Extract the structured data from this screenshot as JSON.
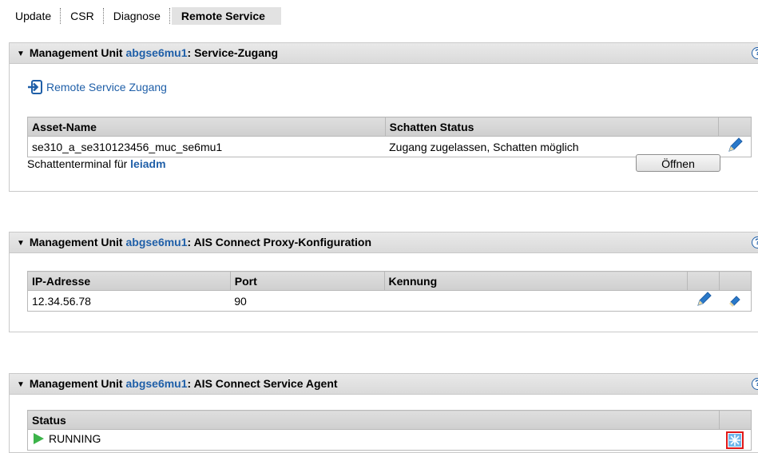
{
  "tabs": [
    {
      "label": "Update"
    },
    {
      "label": "CSR"
    },
    {
      "label": "Diagnose"
    },
    {
      "label": "Remote Service"
    }
  ],
  "accent_color": "#1f5fa8",
  "panels": {
    "service": {
      "prefix": "Management Unit ",
      "unit": "abgse6mu1",
      "suffix": ": Service-Zugang",
      "help": "?",
      "remote_link": "Remote Service Zugang",
      "columns": [
        "Asset-Name",
        "Schatten Status"
      ],
      "row": {
        "asset": "se310_a_se310123456_muc_se6mu1",
        "status": "Zugang zugelassen, Schatten möglich"
      },
      "shadow_label": "Schattenterminal für ",
      "shadow_user": "leiadm",
      "open_button": "Öffnen"
    },
    "proxy": {
      "prefix": "Management Unit ",
      "unit": "abgse6mu1",
      "suffix": ": AIS Connect Proxy-Konfiguration",
      "help": "?",
      "columns": [
        "IP-Adresse",
        "Port",
        "Kennung"
      ],
      "row": {
        "ip": "12.34.56.78",
        "port": "90",
        "id": ""
      }
    },
    "agent": {
      "prefix": "Management Unit ",
      "unit": "abgse6mu1",
      "suffix": ": AIS Connect Service Agent",
      "help": "?",
      "columns": [
        "Status"
      ],
      "row": {
        "status": "RUNNING"
      }
    }
  },
  "icons": {
    "collapse": "triangle-down-icon",
    "help": "help-icon",
    "enter": "enter-icon",
    "edit": "pencil-icon",
    "remove": "eraser-icon",
    "running": "play-icon",
    "action": "snowflake-icon"
  }
}
